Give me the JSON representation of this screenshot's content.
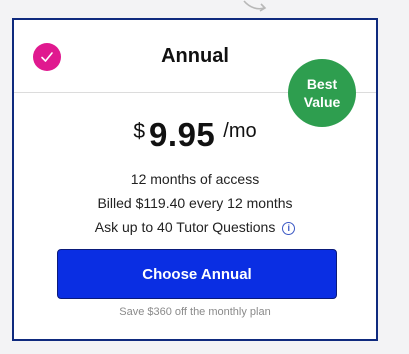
{
  "plan": {
    "title": "Annual",
    "selected": true,
    "badge_line1": "Best",
    "badge_line2": "Value",
    "price": {
      "currency": "$",
      "amount": "9.95",
      "period": "/mo"
    },
    "features": [
      "12 months of access",
      "Billed $119.40 every 12 months",
      "Ask up to 40 Tutor Questions"
    ],
    "info_icon": "info-icon",
    "button_label": "Choose Annual",
    "savings_note": "Save $360 off the monthly plan"
  },
  "colors": {
    "card_border": "#0f2a7e",
    "check_bg": "#e0198f",
    "badge_bg": "#2e9e4f",
    "button_bg": "#0a2ee3"
  }
}
